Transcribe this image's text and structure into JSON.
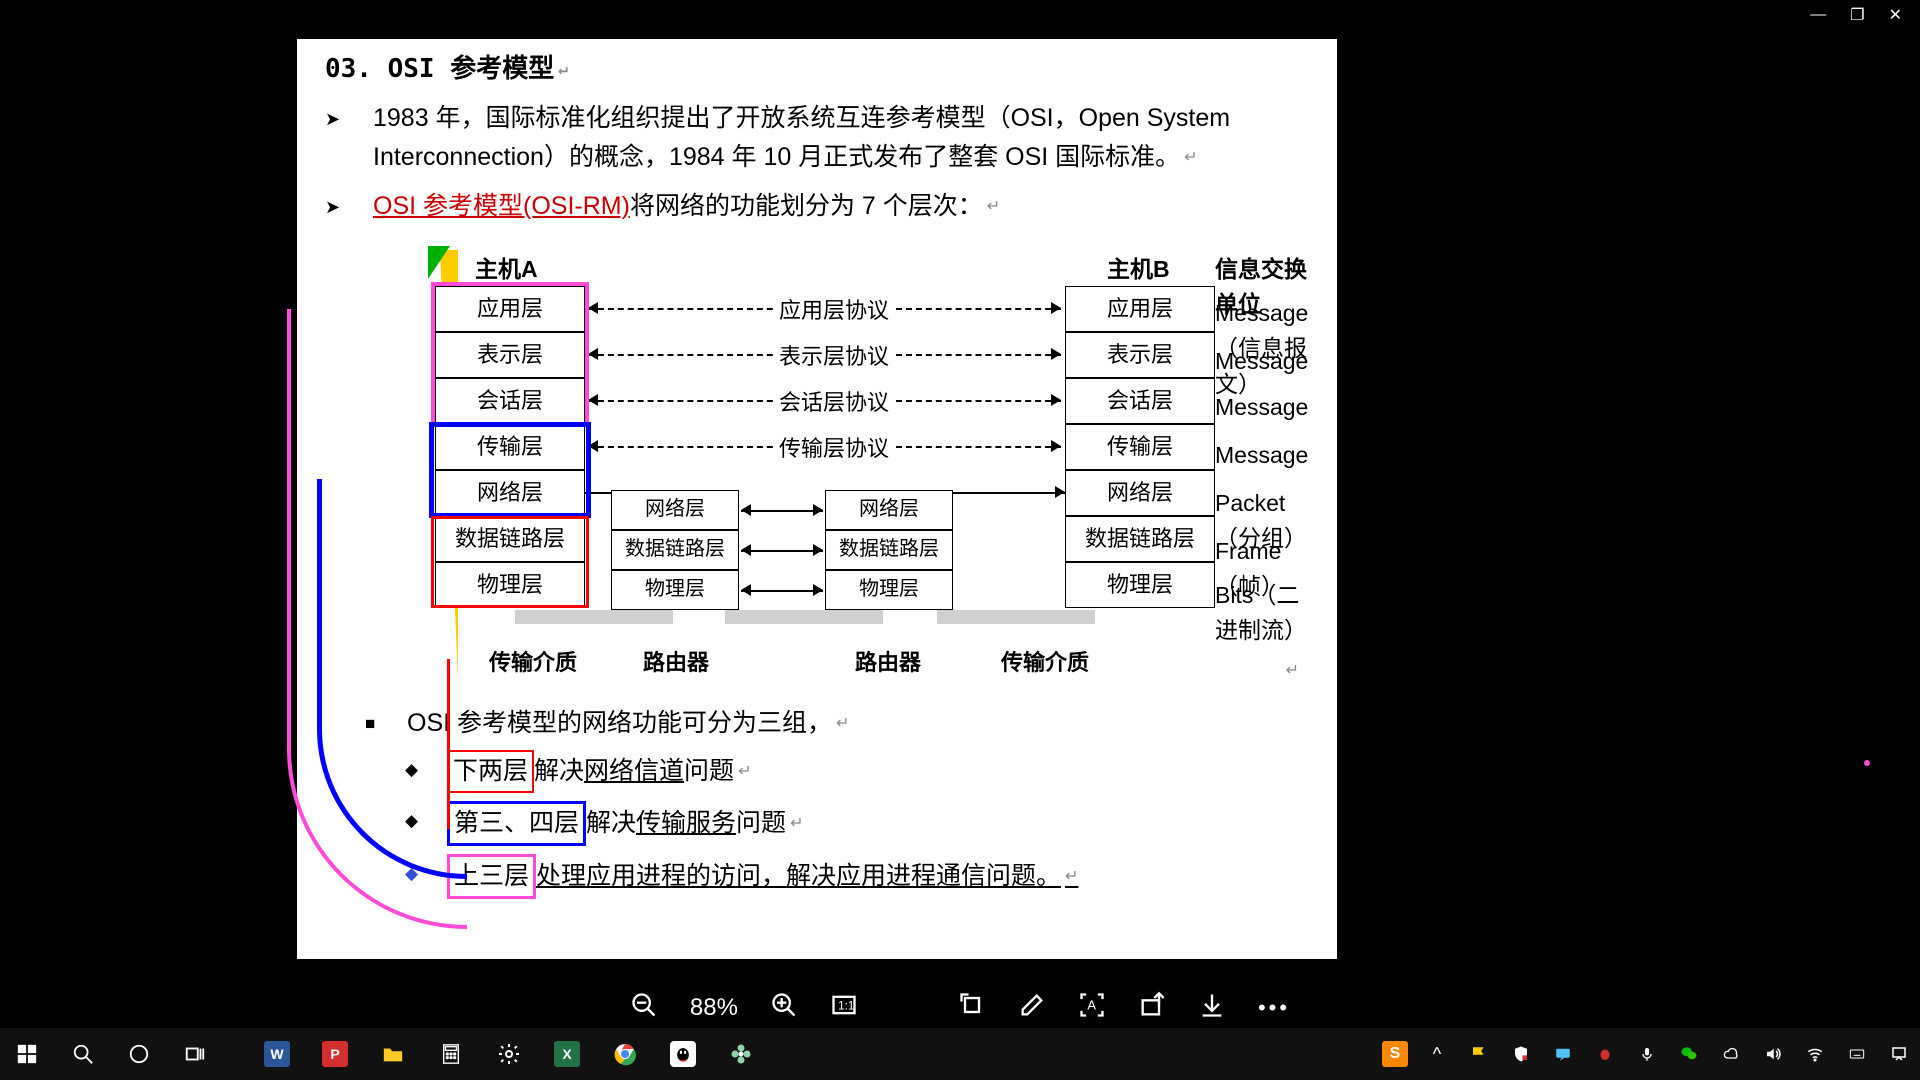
{
  "titlebar": {
    "min": "—",
    "max": "❐",
    "close": "✕"
  },
  "doc": {
    "heading": "03. OSI 参考模型",
    "para1": "1983 年，国际标准化组织提出了开放系统互连参考模型（OSI，Open System Interconnection）的概念，1984 年 10 月正式发布了整套 OSI 国际标准。",
    "para2_link": "OSI 参考模型(OSI-RM)",
    "para2_rest": "将网络的功能划分为 7 个层次：",
    "hostA": "主机A",
    "hostB": "主机B",
    "infoHeader": "信息交换单位",
    "layers": [
      "应用层",
      "表示层",
      "会话层",
      "传输层",
      "网络层",
      "数据链路层",
      "物理层"
    ],
    "protocols": [
      "应用层协议",
      "表示层协议",
      "会话层协议",
      "传输层协议"
    ],
    "router_layers": [
      "网络层",
      "数据链路层",
      "物理层"
    ],
    "info": [
      "Message（信息报文）",
      "Message",
      "Message",
      "Message",
      "Packet（分组）",
      "Frame（帧）",
      "Bits（二进制流）"
    ],
    "media": "传输介质",
    "router": "路由器",
    "body1": "OSI 参考模型的网络功能可分为三组，",
    "b2a": "下两层",
    "b2b": "解决",
    "b2c": "网络信道",
    "b2d": "问题",
    "b3a": "第三、四层",
    "b3b": "解决",
    "b3c": "传输服务",
    "b3d": "问题",
    "b4a": "上三层",
    "b4b": "处理应用进程的访问，解决应用进程通信问题。"
  },
  "viewer": {
    "zoom": "88%"
  },
  "taskbar": {
    "word": "W",
    "pdf": "P",
    "excel": "X",
    "sogou": "S"
  }
}
